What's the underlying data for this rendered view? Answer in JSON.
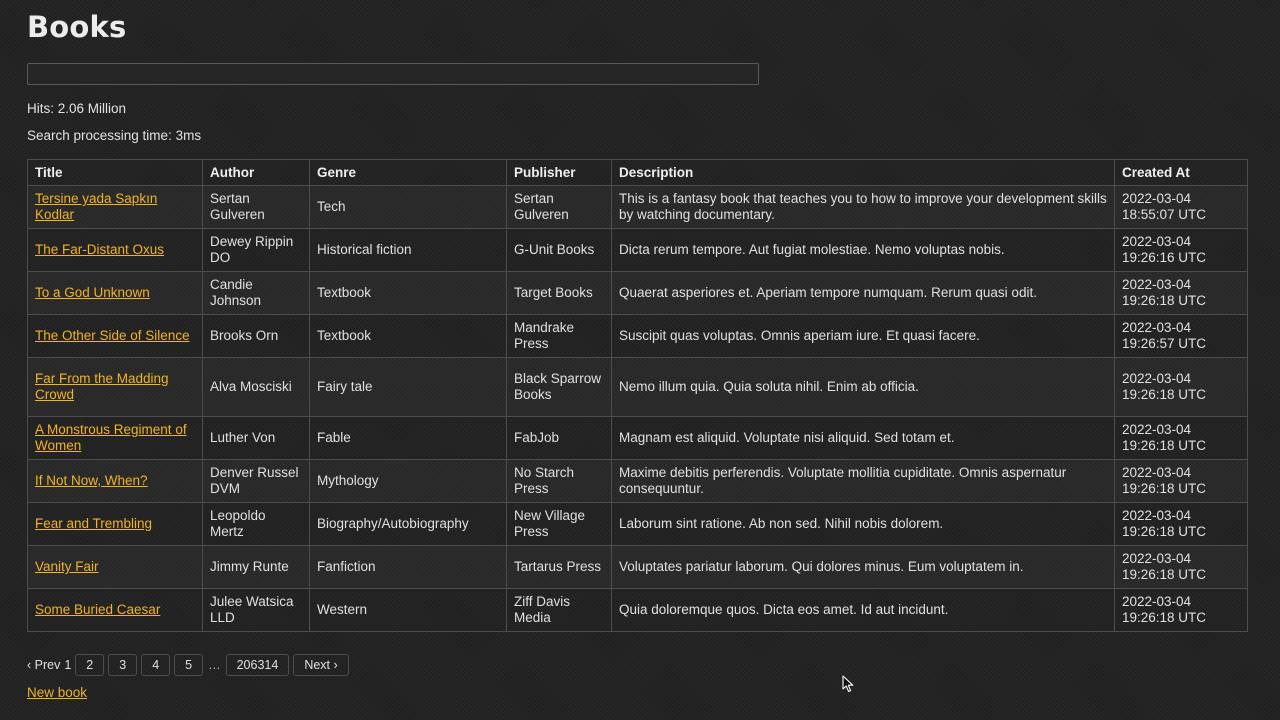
{
  "page": {
    "title": "Books"
  },
  "search": {
    "value": "",
    "placeholder": ""
  },
  "stats": {
    "hits": "Hits: 2.06 Million",
    "processing_time": "Search processing time: 3ms"
  },
  "table": {
    "headers": [
      "Title",
      "Author",
      "Genre",
      "Publisher",
      "Description",
      "Created At"
    ],
    "rows": [
      {
        "title": "Tersine yada Sapkın Kodlar",
        "author": "Sertan Gulveren",
        "genre": "Tech",
        "publisher": "Sertan Gulveren",
        "description": "This is a fantasy book that teaches you to how to improve your development skills by watching documentary.",
        "created_at": "2022-03-04 18:55:07 UTC"
      },
      {
        "title": "The Far-Distant Oxus",
        "author": "Dewey Rippin DO",
        "genre": "Historical fiction",
        "publisher": "G-Unit Books",
        "description": "Dicta rerum tempore. Aut fugiat molestiae. Nemo voluptas nobis.",
        "created_at": "2022-03-04 19:26:16 UTC"
      },
      {
        "title": "To a God Unknown",
        "author": "Candie Johnson",
        "genre": "Textbook",
        "publisher": "Target Books",
        "description": "Quaerat asperiores et. Aperiam tempore numquam. Rerum quasi odit.",
        "created_at": "2022-03-04 19:26:18 UTC"
      },
      {
        "title": "The Other Side of Silence",
        "author": "Brooks Orn",
        "genre": "Textbook",
        "publisher": "Mandrake Press",
        "description": "Suscipit quas voluptas. Omnis aperiam iure. Et quasi facere.",
        "created_at": "2022-03-04 19:26:57 UTC"
      },
      {
        "title": "Far From the Madding Crowd",
        "author": "Alva Mosciski",
        "genre": "Fairy tale",
        "publisher": "Black Sparrow Books",
        "description": "Nemo illum quia. Quia soluta nihil. Enim ab officia.",
        "created_at": "2022-03-04 19:26:18 UTC"
      },
      {
        "title": "A Monstrous Regiment of Women",
        "author": "Luther Von",
        "genre": "Fable",
        "publisher": "FabJob",
        "description": "Magnam est aliquid. Voluptate nisi aliquid. Sed totam et.",
        "created_at": "2022-03-04 19:26:18 UTC"
      },
      {
        "title": "If Not Now, When?",
        "author": "Denver Russel DVM",
        "genre": "Mythology",
        "publisher": "No Starch Press",
        "description": "Maxime debitis perferendis. Voluptate mollitia cupiditate. Omnis aspernatur consequuntur.",
        "created_at": "2022-03-04 19:26:18 UTC"
      },
      {
        "title": "Fear and Trembling",
        "author": "Leopoldo Mertz",
        "genre": "Biography/Autobiography",
        "publisher": "New Village Press",
        "description": "Laborum sint ratione. Ab non sed. Nihil nobis dolorem.",
        "created_at": "2022-03-04 19:26:18 UTC"
      },
      {
        "title": "Vanity Fair",
        "author": "Jimmy Runte",
        "genre": "Fanfiction",
        "publisher": "Tartarus Press",
        "description": "Voluptates pariatur laborum. Qui dolores minus. Eum voluptatem in.",
        "created_at": "2022-03-04 19:26:18 UTC"
      },
      {
        "title": "Some Buried Caesar",
        "author": "Julee Watsica LLD",
        "genre": "Western",
        "publisher": "Ziff Davis Media",
        "description": "Quia doloremque quos. Dicta eos amet. Id aut incidunt.",
        "created_at": "2022-03-04 19:26:18 UTC"
      }
    ]
  },
  "pagination": {
    "prev": "‹ Prev",
    "current": "1",
    "pages": [
      "2",
      "3",
      "4",
      "5"
    ],
    "gap": "…",
    "last": "206314",
    "next": "Next ›"
  },
  "links": {
    "new_book": "New book"
  },
  "colors": {
    "background": "#232323",
    "link": "#f2b420",
    "border": "#4d4d4d",
    "text": "#e0e0e0"
  },
  "icons": {
    "cursor": "mouse-pointer-icon"
  }
}
